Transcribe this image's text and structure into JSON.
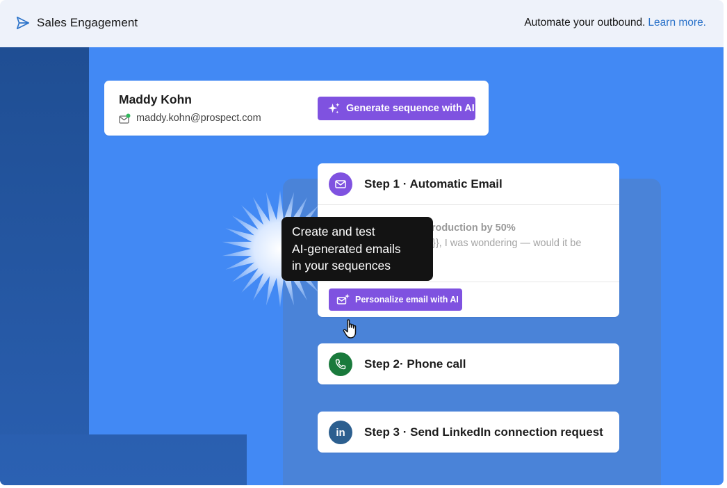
{
  "header": {
    "brand_icon": "paper-plane-icon",
    "brand_label": "Sales Engagement",
    "tagline_text": "Automate your outbound.",
    "learn_more_link": "Learn more."
  },
  "contact": {
    "name": "Maddy Kohn",
    "email_icon": "email-verified-icon",
    "email": "maddy.kohn@prospect.com",
    "generate_button_icon": "sparkle-icon",
    "generate_button_label": "Generate sequence with AI"
  },
  "steps": [
    {
      "title": "Step 1 · Automatic Email",
      "icon": "mail-icon",
      "icon_bg": "#7f52e0",
      "email_subject_visible": "production by 50%",
      "email_body_visible": "}},  I was wondering — would it be",
      "personalize_button_icon": "mail-sparkle-icon",
      "personalize_button_label": "Personalize email with AI"
    },
    {
      "title": "Step 2· Phone call",
      "icon": "phone-icon",
      "icon_bg": "#1a7a3c"
    },
    {
      "title": "Step 3 · Send LinkedIn connection request",
      "icon": "linkedin-icon",
      "icon_bg": "#2c5f8f"
    }
  ],
  "tooltip": {
    "line1": "Create and test",
    "line2": "AI-generated emails",
    "line3": "in your sequences"
  },
  "colors": {
    "accent_purple": "#7f52e0",
    "stage_blue": "#4289f4",
    "link_blue": "#2a72c9",
    "tooltip_bg": "#131313"
  }
}
